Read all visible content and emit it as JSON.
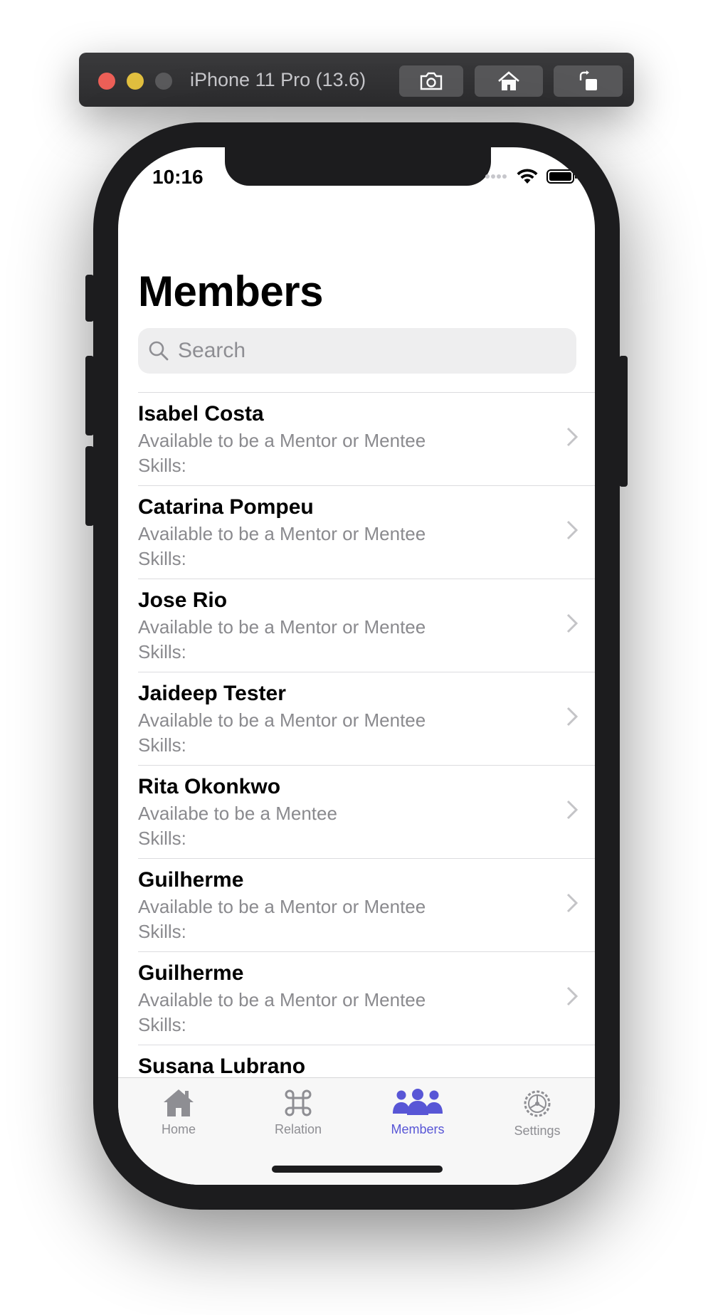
{
  "simulator": {
    "title": "iPhone 11 Pro (13.6)",
    "buttons": [
      "camera-icon",
      "home-icon",
      "rotate-icon"
    ]
  },
  "status_bar": {
    "time": "10:16"
  },
  "page": {
    "title": "Members"
  },
  "search": {
    "placeholder": "Search"
  },
  "members": [
    {
      "name": "Isabel Costa",
      "availability": "Available to be a Mentor or Mentee",
      "skills": "Skills:"
    },
    {
      "name": "Catarina Pompeu",
      "availability": "Available to be a Mentor or Mentee",
      "skills": "Skills:"
    },
    {
      "name": "Jose Rio",
      "availability": "Available to be a Mentor or Mentee",
      "skills": "Skills:"
    },
    {
      "name": "Jaideep Tester",
      "availability": "Available to be a Mentor or Mentee",
      "skills": "Skills:"
    },
    {
      "name": "Rita Okonkwo",
      "availability": "Availabe to be a Mentee",
      "skills": "Skills:"
    },
    {
      "name": "Guilherme",
      "availability": "Available to be a Mentor or Mentee",
      "skills": "Skills:"
    },
    {
      "name": "Guilherme",
      "availability": "Available to be a Mentor or Mentee",
      "skills": "Skills:"
    },
    {
      "name": "Susana Lubrano",
      "availability": "",
      "skills": ""
    }
  ],
  "tabs": [
    {
      "label": "Home",
      "icon": "house-icon",
      "active": false
    },
    {
      "label": "Relation",
      "icon": "command-icon",
      "active": false
    },
    {
      "label": "Members",
      "icon": "people-icon",
      "active": true
    },
    {
      "label": "Settings",
      "icon": "gear-icon",
      "active": false
    }
  ],
  "colors": {
    "accent": "#5856d6",
    "inactive": "#8e8e93"
  }
}
